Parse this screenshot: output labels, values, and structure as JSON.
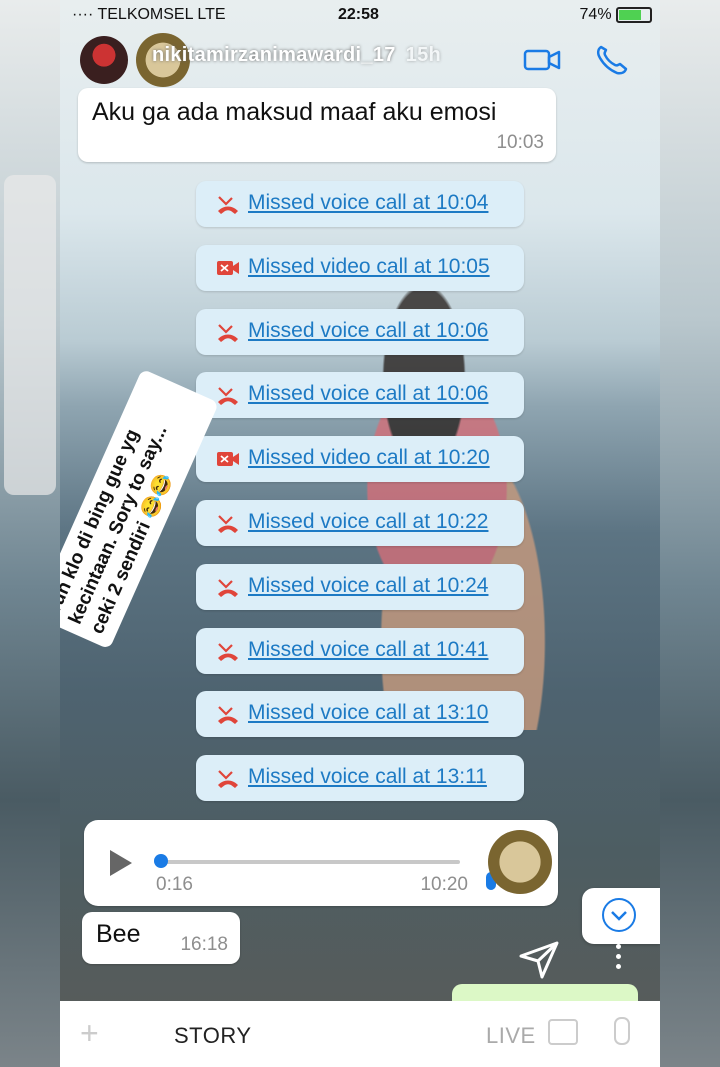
{
  "status_bar": {
    "carrier": "···· TELKOMSEL  LTE",
    "time": "22:58",
    "battery": "74%"
  },
  "header": {
    "username": "nikitamirzanimawardi_17",
    "age": "15h"
  },
  "messages": {
    "first": {
      "text": "Aku ga ada maksud maaf aku emosi",
      "time": "10:03"
    },
    "last": {
      "text": "Bee",
      "time": "16:18"
    }
  },
  "calls": [
    {
      "type": "voice",
      "label": "Missed voice call at 10:04"
    },
    {
      "type": "video",
      "label": "Missed video call at 10:05"
    },
    {
      "type": "voice",
      "label": "Missed voice call at 10:06"
    },
    {
      "type": "voice",
      "label": "Missed voice call at 10:06"
    },
    {
      "type": "video",
      "label": "Missed video call at 10:20"
    },
    {
      "type": "voice",
      "label": "Missed voice call at 10:22"
    },
    {
      "type": "voice",
      "label": "Missed voice call at 10:24"
    },
    {
      "type": "voice",
      "label": "Missed voice call at 10:41"
    },
    {
      "type": "voice",
      "label": "Missed voice call at 13:10"
    },
    {
      "type": "voice",
      "label": "Missed voice call at 13:11"
    }
  ],
  "voice_note": {
    "duration": "0:16",
    "time": "10:20",
    "progress": 0
  },
  "sticker": {
    "line1": "Tuh klo di bing gue yg",
    "line2": "kecintaan. Sory to say...",
    "line3": "ceki 2 sendiri 😂😂"
  },
  "bottom_bar": {
    "story": "STORY",
    "live": "LIVE"
  },
  "colors": {
    "link_blue": "#1d7ac4",
    "missed_red": "#e0453a",
    "call_bubble": "#dceef8"
  }
}
